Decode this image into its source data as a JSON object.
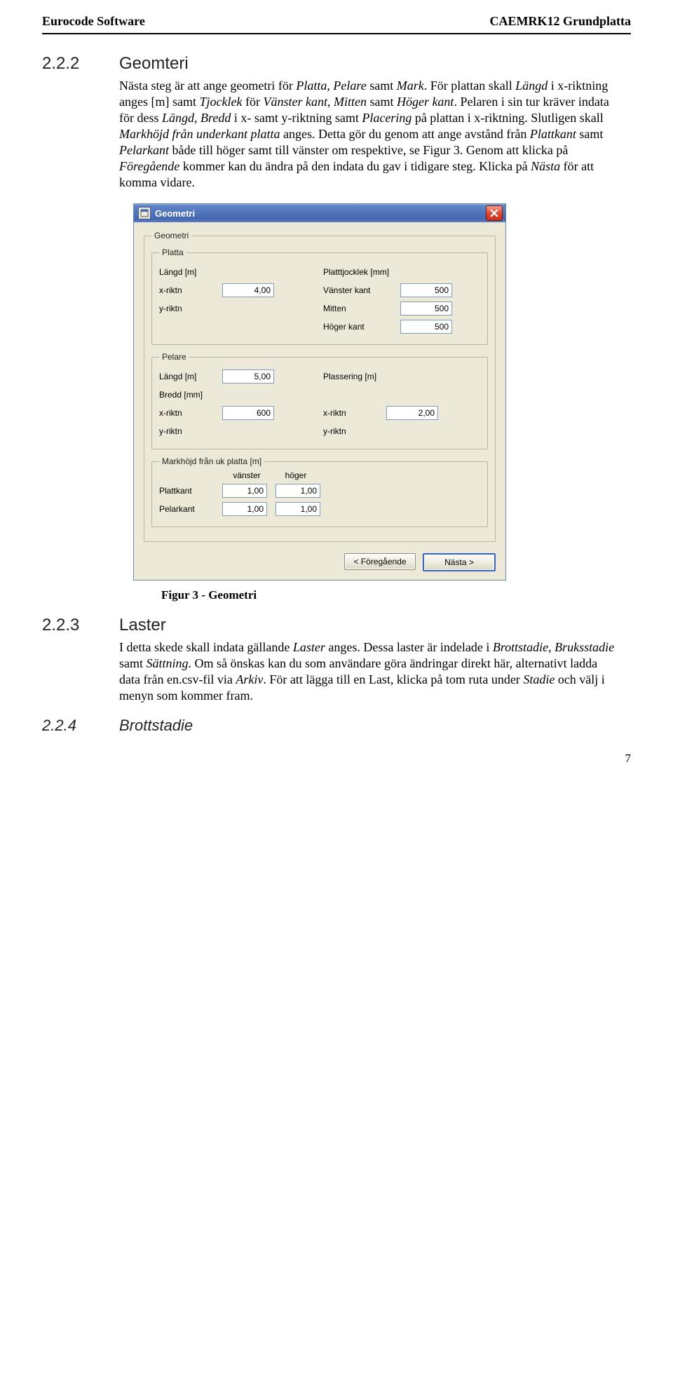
{
  "header": {
    "left": "Eurocode Software",
    "right": "CAEMRK12 Grundplatta"
  },
  "s222": {
    "num": "2.2.2",
    "title": "Geomteri",
    "p1_prefix": "Nästa steg är att ange geometri för ",
    "i_platta": "Platta",
    "c1": ", ",
    "i_pelare": "Pelare",
    "c2": " samt ",
    "i_mark": "Mark",
    "c3": ". För plattan skall ",
    "i_langd": "Längd",
    "c4": " i x-riktning anges [m] samt ",
    "i_tjocklek": "Tjocklek",
    "c5": " för ",
    "i_vk": "Vänster kant",
    "c6": ", ",
    "i_mitten": "Mitten",
    "c7": " samt ",
    "i_hk": "Höger kant",
    "c8": ". Pelaren i sin tur kräver indata för dess ",
    "i_langd2": "Längd",
    "c9": ", ",
    "i_bredd": "Bredd",
    "c10": " i x- samt y-riktning samt ",
    "i_placering": "Placering",
    "c11": " på plattan i x-riktning. Slutligen skall ",
    "i_markhojd": "Markhöjd från underkant platta",
    "c12": " anges. Detta gör du genom att ange avstånd från ",
    "i_plattkant": "Plattkant",
    "c13": " samt ",
    "i_pelarkant": "Pelarkant",
    "c14": " både till höger samt till vänster om respektive, se Figur 3. Genom att klicka på ",
    "i_foregaende": "Föregående",
    "c15": " kommer kan du ändra på den indata du gav i tidigare steg. Klicka på ",
    "i_nasta": "Nästa",
    "c16": " för att komma vidare."
  },
  "dialog": {
    "title": "Geometri",
    "grp_geometri": "Geometri",
    "grp_platta": "Platta",
    "lbl_langd_m": "Längd [m]",
    "lbl_platttjocklek": "Platttjocklek [mm]",
    "lbl_xriktn": "x-riktn",
    "lbl_yriktn": "y-riktn",
    "val_x_len": "4,00",
    "lbl_vanster_kant": "Vänster kant",
    "lbl_mitten": "Mitten",
    "lbl_hoger_kant": "Höger kant",
    "val_vk": "500",
    "val_mitten": "500",
    "val_hk": "500",
    "grp_pelare": "Pelare",
    "val_pelare_langd": "5,00",
    "lbl_plassering": "Plassering [m]",
    "lbl_bredd": "Bredd [mm]",
    "val_bredd_x": "600",
    "val_plass_x": "2,00",
    "grp_markhojd": "Markhöjd från uk platta [m]",
    "col_vanster": "vänster",
    "col_hoger": "höger",
    "lbl_plattkant": "Plattkant",
    "lbl_pelarkant": "Pelarkant",
    "mk_plattkant_v": "1,00",
    "mk_plattkant_h": "1,00",
    "mk_pelarkant_v": "1,00",
    "mk_pelarkant_h": "1,00",
    "btn_prev": "< Föregående",
    "btn_next": "Nästa >"
  },
  "caption": "Figur 3 - Geometri",
  "s223": {
    "num": "2.2.3",
    "title": "Laster",
    "p_prefix": "I detta skede skall indata gällande ",
    "i_laster": "Laster",
    "c1": " anges. Dessa laster är indelade i ",
    "i_brott": "Brottstadie",
    "c2": ", ",
    "i_bruks": "Bruksstadie",
    "c3": " samt ",
    "i_sattning": "Sättning",
    "c4": ". Om så önskas kan du som användare göra ändringar direkt här, alternativt ladda data från en.csv-fil via ",
    "i_arkiv": "Arkiv",
    "c5": ". För att lägga till en Last, klicka på tom ruta under ",
    "i_stadie": "Stadie",
    "c6": " och välj i menyn som kommer fram."
  },
  "s224": {
    "num": "2.2.4",
    "title": "Brottstadie"
  },
  "page_number": "7"
}
